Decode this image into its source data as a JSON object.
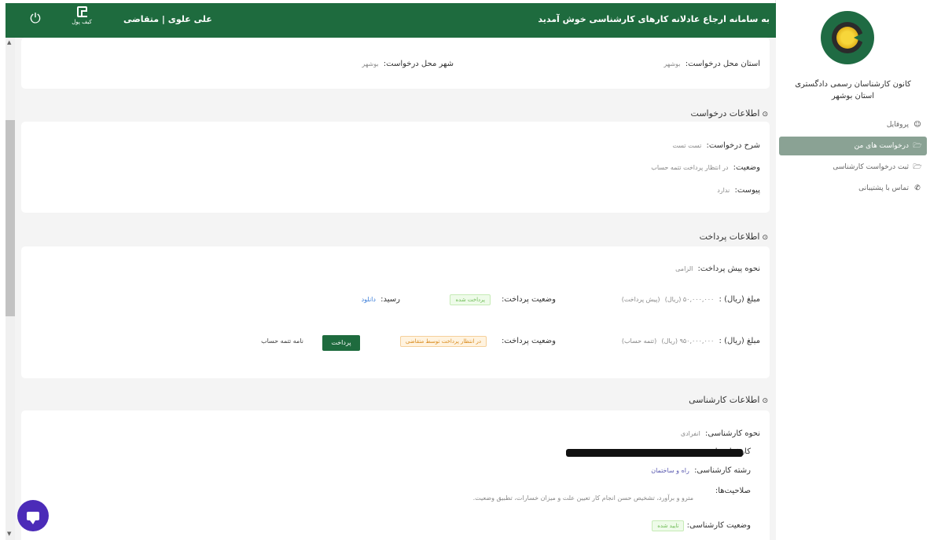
{
  "sidebar": {
    "org_name_line1": "کانون کارشناسان رسمی دادگستری",
    "org_name_line2": "استان بوشهر",
    "items": [
      {
        "label": "پروفایل",
        "icon": "user-icon"
      },
      {
        "label": "درخواست های من",
        "icon": "folder-icon"
      },
      {
        "label": "ثبت درخواست کارشناسی",
        "icon": "folder-icon"
      },
      {
        "label": "تماس با پشتیبانی",
        "icon": "phone-icon"
      }
    ]
  },
  "header": {
    "welcome": "به سامانه ارجاع عادلانه کارهای کارشناسی خوش آمدید",
    "username": "علی علوی | متقاضی",
    "wallet_label": "کیف پول",
    "power_icon": "power-icon"
  },
  "location": {
    "province_label": "استان محل درخواست:",
    "province_value": "بوشهر",
    "city_label": "شهر محل درخواست:",
    "city_value": "بوشهر"
  },
  "request_info": {
    "title": "اطلاعات درخواست",
    "desc_label": "شرح درخواست:",
    "desc_value": "تست تست",
    "status_label": "وضعیت:",
    "status_value": "در انتظار پرداخت تتمه حساب",
    "attach_label": "پیوست:",
    "attach_value": "ندارد"
  },
  "payment_info": {
    "title": "اطلاعات پرداخت",
    "method_label": "نحوه پیش پرداخت:",
    "method_value": "الزامی",
    "rows": [
      {
        "amount_label": "مبلغ (ریال) :",
        "amount_value": "۵۰,۰۰۰,۰۰۰ (ریال)",
        "amount_note": "(پیش پرداخت)",
        "status_label": "وضعیت پرداخت:",
        "status_badge": "پرداخت شده",
        "receipt_label": "رسید:",
        "receipt_link": "دانلود"
      },
      {
        "amount_label": "مبلغ (ریال) :",
        "amount_value": "۹۵۰,۰۰۰,۰۰۰ (ریال)",
        "amount_note": "(تتمه حساب)",
        "status_label": "وضعیت پرداخت:",
        "status_badge": "در انتظار پرداخت توسط متقاضی",
        "pay_button": "پرداخت",
        "letter_link": "نامه تتمه حساب"
      }
    ]
  },
  "expert_info": {
    "title": "اطلاعات کارشناسی",
    "method_label": "نحوه کارشناسی:",
    "method_value": "انفرادی",
    "expert_label": "کارشناس ا:",
    "field_label": "رشته کارشناسی:",
    "field_value": "راه و ساختمان",
    "competence_label": "صلاحیت‌ها:",
    "competence_value": "مترو و برآورد، تشخیص حسن انجام کار تعیین علت و میزان خسارات، تطبیق وضعیت.",
    "status_label": "وضعیت کارشناسی:",
    "status_badge": "تایید شده"
  },
  "colors": {
    "brand_green": "#1e6b3e",
    "active_nav": "#8aa294",
    "chat": "#4b2bb8"
  }
}
